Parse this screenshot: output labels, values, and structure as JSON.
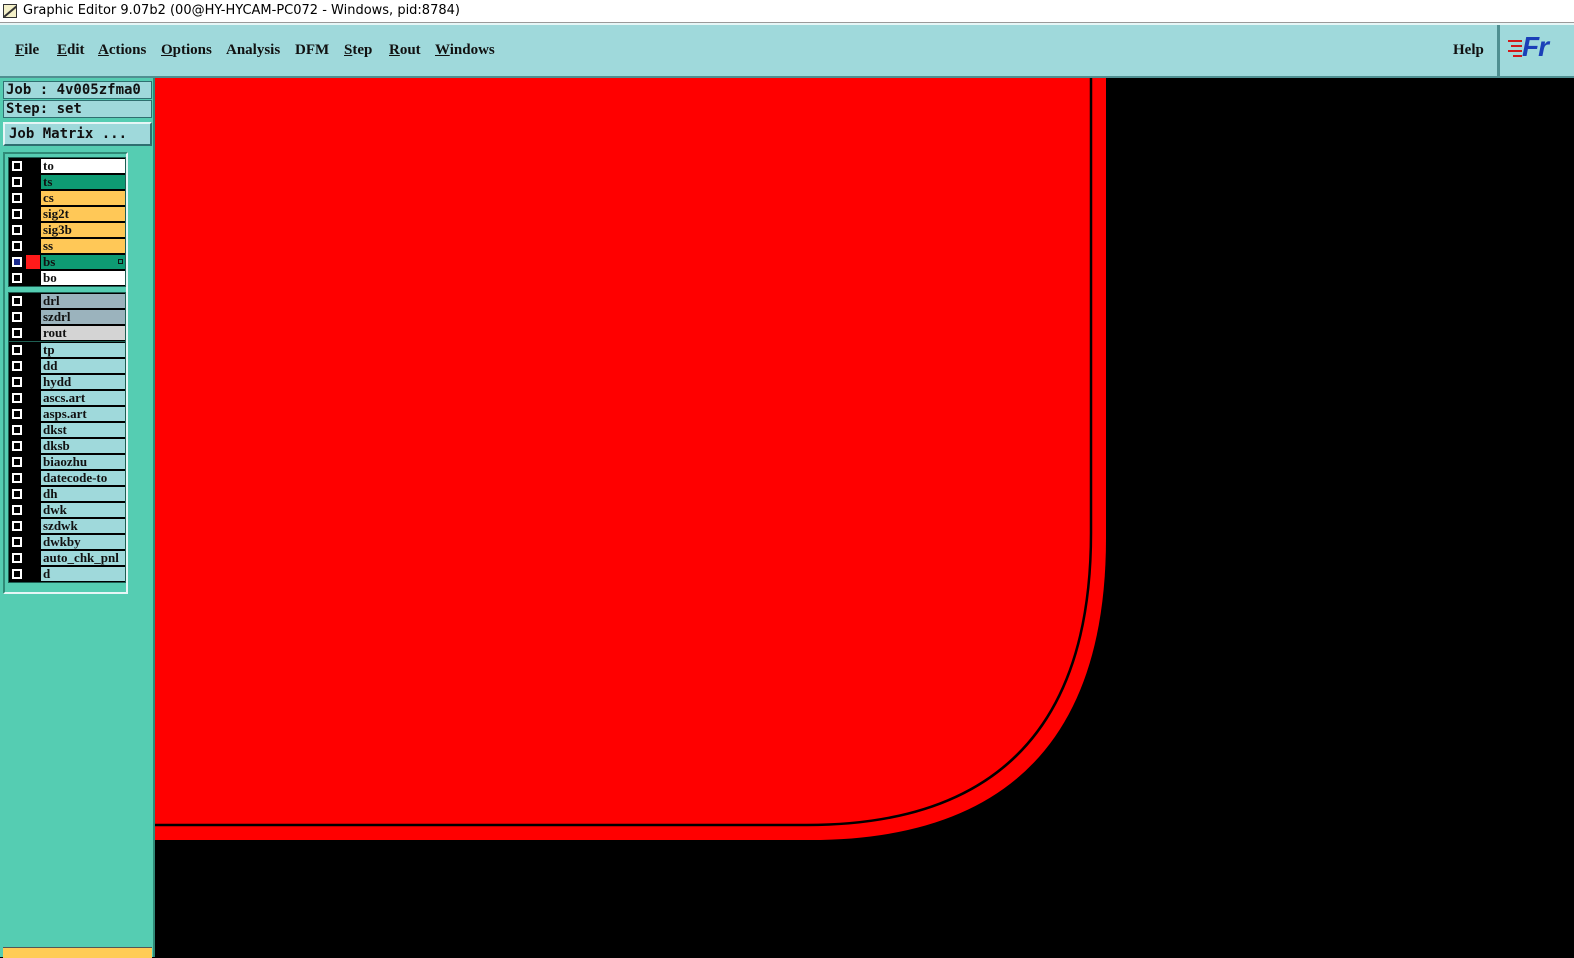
{
  "window": {
    "title": "Graphic Editor 9.07b2 (00@HY-HYCAM-PC072 - Windows, pid:8784)"
  },
  "menu": {
    "items": [
      {
        "label": "File",
        "underline": "F",
        "rest": "ile"
      },
      {
        "label": "Edit",
        "underline": "E",
        "rest": "dit"
      },
      {
        "label": "Actions",
        "underline": "A",
        "rest": "ctions"
      },
      {
        "label": "Options",
        "underline": "O",
        "rest": "ptions"
      },
      {
        "label": "Analysis",
        "underline": "",
        "rest": "Analysis"
      },
      {
        "label": "DFM",
        "underline": "",
        "rest": "DFM"
      },
      {
        "label": "Step",
        "underline": "S",
        "rest": "tep"
      },
      {
        "label": "Rout",
        "underline": "R",
        "rest": "out"
      },
      {
        "label": "Windows",
        "underline": "W",
        "rest": "indows"
      }
    ],
    "help": "Help",
    "logo_text": "Fr"
  },
  "panel": {
    "job": "Job : 4v005zfma0",
    "step": "Step: set",
    "job_matrix": "Job Matrix ..."
  },
  "layer_groups": [
    {
      "layers": [
        {
          "name": "to",
          "color": "#ffffff",
          "active": false
        },
        {
          "name": "ts",
          "color": "#0e9b73",
          "active": false
        },
        {
          "name": "cs",
          "color": "#ffc857",
          "active": false
        },
        {
          "name": "sig2t",
          "color": "#ffc857",
          "active": false
        },
        {
          "name": "sig3b",
          "color": "#ffc857",
          "active": false
        },
        {
          "name": "ss",
          "color": "#ffc857",
          "active": false
        },
        {
          "name": "bs",
          "color": "#0e9b73",
          "active": true
        },
        {
          "name": "bo",
          "color": "#ffffff",
          "active": false
        }
      ]
    },
    {
      "layers": [
        {
          "name": "drl",
          "color": "#9bb3bd",
          "active": false
        },
        {
          "name": "szdrl",
          "color": "#9bb3bd",
          "active": false
        },
        {
          "name": "rout",
          "color": "#d4d4d4",
          "active": false
        }
      ]
    },
    {
      "layers": [
        {
          "name": "tp",
          "color": "#9fd9db",
          "active": false
        },
        {
          "name": "dd",
          "color": "#9fd9db",
          "active": false
        },
        {
          "name": "hydd",
          "color": "#9fd9db",
          "active": false
        },
        {
          "name": "ascs.art",
          "color": "#9fd9db",
          "active": false
        },
        {
          "name": "asps.art",
          "color": "#9fd9db",
          "active": false
        },
        {
          "name": "dkst",
          "color": "#9fd9db",
          "active": false
        },
        {
          "name": "dksb",
          "color": "#9fd9db",
          "active": false
        },
        {
          "name": "biaozhu",
          "color": "#9fd9db",
          "active": false
        },
        {
          "name": "datecode-to",
          "color": "#9fd9db",
          "active": false
        },
        {
          "name": "dh",
          "color": "#9fd9db",
          "active": false
        },
        {
          "name": "dwk",
          "color": "#9fd9db",
          "active": false
        },
        {
          "name": "szdwk",
          "color": "#9fd9db",
          "active": false
        },
        {
          "name": "dwkby",
          "color": "#9fd9db",
          "active": false
        },
        {
          "name": "auto_chk_pnl",
          "color": "#9fd9db",
          "active": false
        },
        {
          "name": "d",
          "color": "#9fd9db",
          "active": false
        }
      ]
    }
  ],
  "canvas": {
    "background": "#000000",
    "fill_color": "#ff0000",
    "outline_color": "#000000"
  }
}
